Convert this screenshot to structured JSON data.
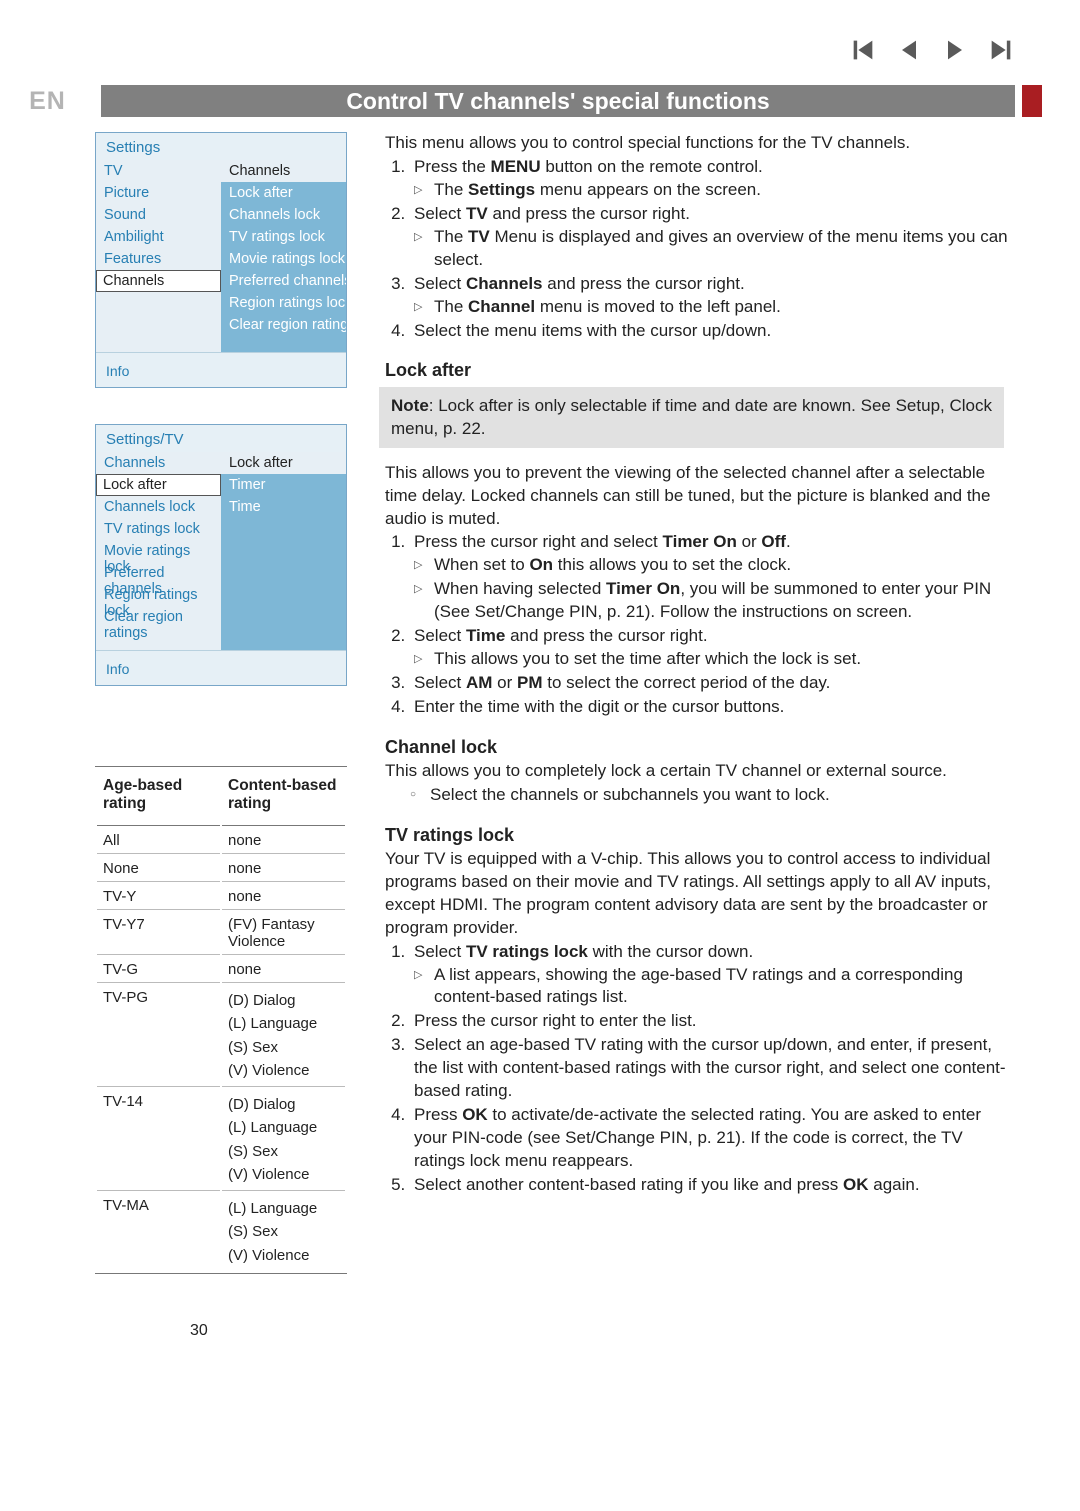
{
  "lang": "EN",
  "title": "Control TV channels' special functions",
  "nav_icons": [
    "skip-back",
    "back",
    "forward",
    "skip-forward"
  ],
  "osd1": {
    "head": "Settings",
    "left_hdr": "TV",
    "right_hdr": "Channels",
    "left": [
      "Picture",
      "Sound",
      "Ambilight",
      "Features"
    ],
    "left_selected": "Channels",
    "right": [
      "Lock after",
      "Channels lock",
      "TV ratings lock",
      "Movie ratings lock",
      "Preferred channels",
      "Region ratings lock",
      "Clear region ratings"
    ],
    "info": "Info"
  },
  "osd2": {
    "head": "Settings/TV",
    "left_hdr": "Channels",
    "right_hdr": "Lock after",
    "left": [
      "Channels lock",
      "TV ratings lock",
      "Movie ratings lock",
      "Preferred channels",
      "Region ratings lock",
      "Clear region ratings"
    ],
    "left_selected": "Lock after",
    "right": [
      "Timer",
      "Time"
    ],
    "info": "Info"
  },
  "ratings": {
    "h1": "Age-based rating",
    "h2": "Content-based rating",
    "rows": [
      {
        "a": "All",
        "c": "none"
      },
      {
        "a": "None",
        "c": "none"
      },
      {
        "a": "TV-Y",
        "c": "none"
      },
      {
        "a": "TV-Y7",
        "c": "(FV) Fantasy Violence"
      },
      {
        "a": "TV-G",
        "c": "none"
      },
      {
        "a": "TV-PG",
        "c": "(D) Dialog\n(L) Language\n(S) Sex\n(V) Violence"
      },
      {
        "a": "TV-14",
        "c": "(D) Dialog\n(L) Language\n(S) Sex\n(V) Violence"
      },
      {
        "a": "TV-MA",
        "c": "(L) Language\n(S) Sex\n(V) Violence"
      }
    ]
  },
  "body": {
    "intro": "This menu allows you to control special functions for the TV channels.",
    "steps1": {
      "s1": "Press the <b>MENU</b> button on the remote control.",
      "s1a": "The <b>Settings</b> menu appears on the screen.",
      "s2": "Select <b>TV</b> and press the cursor right.",
      "s2a": "The <b>TV</b> Menu is displayed and gives an overview of the menu items you can select.",
      "s3": "Select <b>Channels</b> and press the cursor right.",
      "s3a": "The <b>Channel</b> menu is moved to the left panel.",
      "s4": "Select the menu items with the cursor up/down."
    },
    "lockafter": {
      "h": "Lock after",
      "note": "<b>Note</b>: Lock after is only selectable if time and date are known. See Setup, Clock menu, p. 22.",
      "p": "This allows you to prevent the viewing of the selected channel after a selectable time delay. Locked channels can still be tuned, but the picture is blanked and the audio is muted.",
      "s1": "Press the cursor right and select <b>Timer On</b> or <b>Off</b>.",
      "s1a": "When set to <b>On</b> this allows you to set the clock.",
      "s1b": "When having selected <b>Timer On</b>, you will be summoned to enter your PIN (See Set/Change PIN, p. 21). Follow the instructions on screen.",
      "s2": "Select <b>Time</b> and press the cursor right.",
      "s2a": "This allows you to set the time after which the lock is set.",
      "s3": "Select <b>AM</b> or <b>PM</b> to select the correct period of the day.",
      "s4": "Enter the time with the digit or the cursor buttons."
    },
    "chlock": {
      "h": "Channel lock",
      "p": "This allows you to completely lock a certain TV channel or external source.",
      "s1": "Select the channels or subchannels you want to lock."
    },
    "tvr": {
      "h": "TV ratings lock",
      "p": "Your TV is equipped with a V-chip. This allows you to control access to individual programs based on their movie and TV ratings. All settings apply to all AV inputs, except HDMI. The program content advisory data are sent by the broadcaster or program provider.",
      "s1": "Select <b>TV ratings lock</b> with the cursor down.",
      "s1a": "A list appears, showing the age-based TV ratings and a corresponding content-based ratings list.",
      "s2": "Press the cursor right to enter the list.",
      "s3": "Select an age-based TV rating with the cursor up/down, and enter, if present, the list with content-based ratings with the cursor right, and select one content-based rating.",
      "s4": "Press <b>OK</b> to activate/de-activate the selected rating. You are asked to enter your PIN-code (see Set/Change PIN, p. 21). If the code is correct, the TV ratings lock menu reappears.",
      "s5": "Select another content-based rating if you like and press <b>OK</b> again."
    }
  },
  "page": "30"
}
